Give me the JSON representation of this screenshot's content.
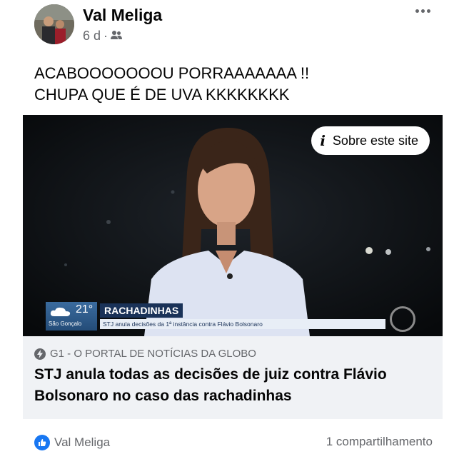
{
  "post": {
    "author": "Val Meliga",
    "time": "6 d",
    "separator": "·",
    "audience_icon": "friends-icon",
    "text_line1": "ACABOOOOOOOU PORRAAAAAAA !!",
    "text_line2": "CHUPA QUE É DE UVA KKKKKKKK"
  },
  "link": {
    "about_label": "Sobre este site",
    "tv": {
      "temperature": "21°",
      "city": "São Gonçalo",
      "topic": "RACHADINHAS",
      "crawl": "STJ anula decisões da 1ª instância contra Flávio Bolsonaro"
    },
    "source": "G1 - O PORTAL DE NOTÍCIAS DA GLOBO",
    "headline": "STJ anula todas as decisões de juiz contra Flávio Bolsonaro no caso das rachadinhas"
  },
  "footer": {
    "reactor": "Val Meliga",
    "shares": "1 compartilhamento"
  },
  "colors": {
    "link_blue": "#1877f2",
    "secondary_text": "#65676b",
    "card_bg": "#f0f2f5"
  }
}
